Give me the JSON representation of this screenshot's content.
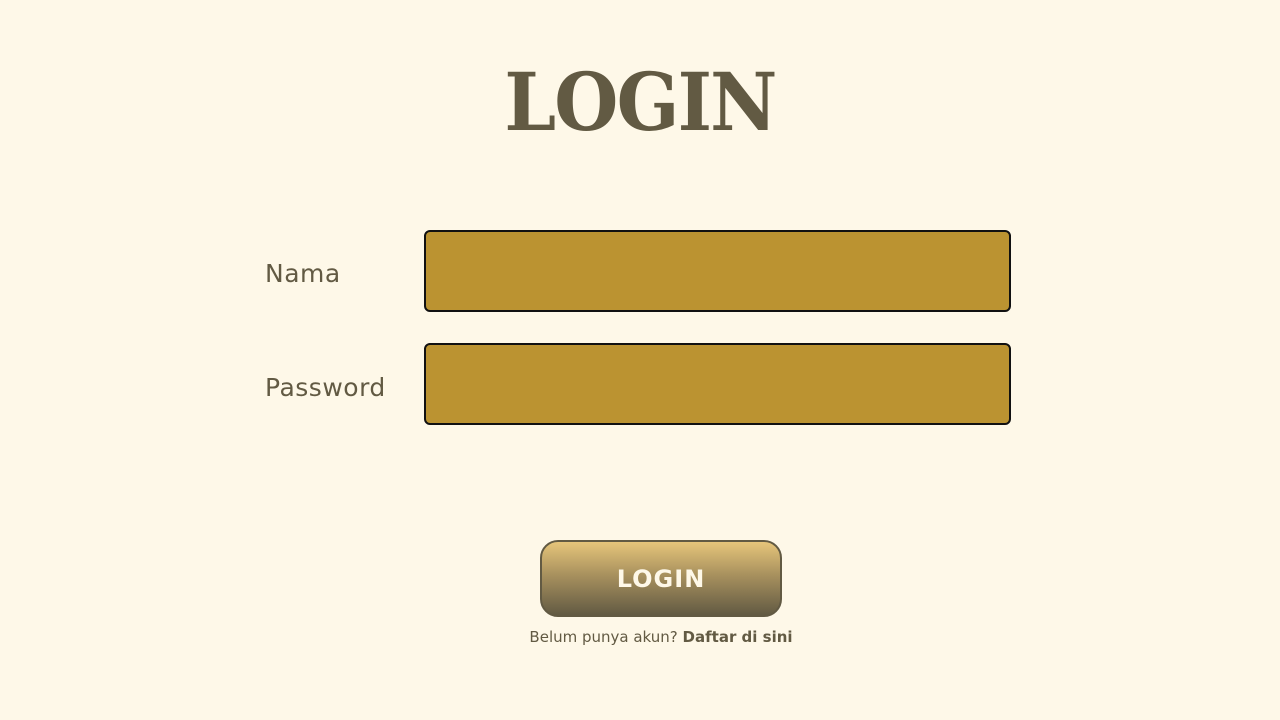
{
  "page": {
    "title": "LOGIN"
  },
  "form": {
    "nama_label": "Nama",
    "nama_value": "",
    "password_label": "Password",
    "password_value": "",
    "submit_label": "LOGIN"
  },
  "register": {
    "prompt": "Belum punya akun?",
    "link_label": "Daftar di sini"
  },
  "colors": {
    "background": "#fef8e8",
    "text": "#625a43",
    "input_fill": "#bb9331",
    "input_border": "#111111",
    "button_gradient_top": "#e6c57a",
    "button_gradient_bottom": "#625a43"
  }
}
